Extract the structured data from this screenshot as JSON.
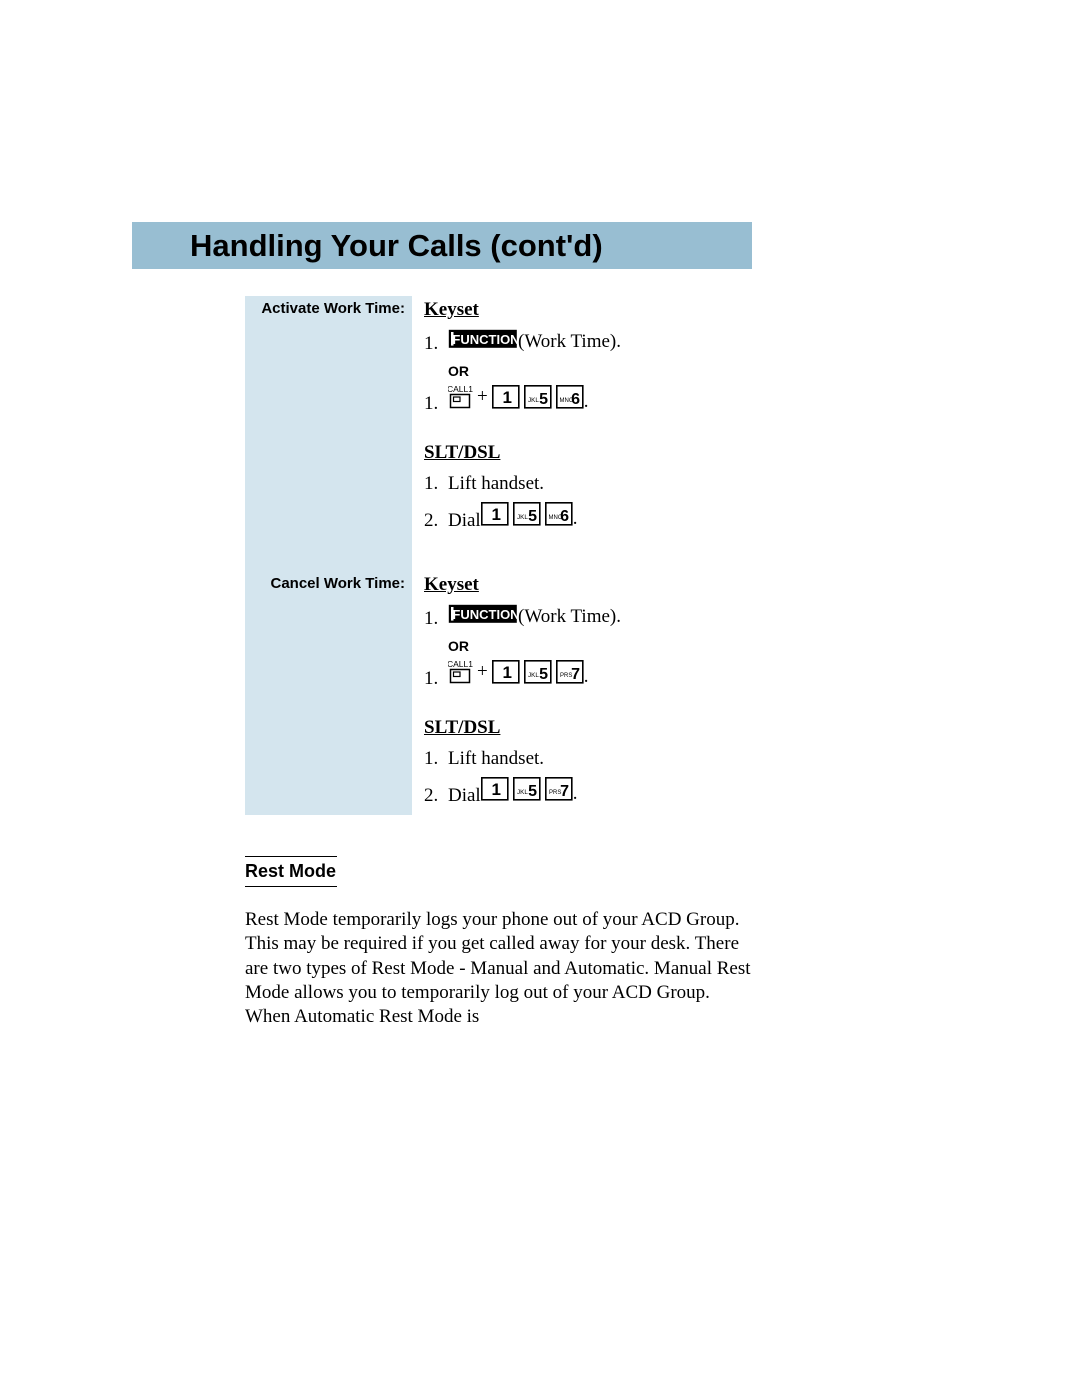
{
  "title": "Handling Your Calls (cont'd)",
  "side": {
    "activate": "Activate Work Time:",
    "cancel": "Cancel Work Time:"
  },
  "labels": {
    "keyset": "Keyset",
    "slt": "SLT/DSL",
    "or": "OR",
    "work_time_suffix": " (Work Time).",
    "lift": "Lift handset.",
    "dial": "Dial ",
    "plus": " + ",
    "period": "."
  },
  "keys": {
    "function": "FUNCTION",
    "call1": "CALL1",
    "one": {
      "sub": "",
      "main": "1"
    },
    "five": {
      "sub": "JKL",
      "main": "5"
    },
    "six": {
      "sub": "MNO",
      "main": "6"
    },
    "seven": {
      "sub": "PRS",
      "main": "7"
    }
  },
  "rest": {
    "heading": "Rest Mode",
    "body": "Rest Mode temporarily logs your phone out of your ACD Group.  This may be required if you get called away for your desk.  There are two types of Rest Mode - Manual and Automatic.  Manual Rest Mode allows you to temporarily log out of your ACD Group.  When Automatic Rest Mode is"
  }
}
